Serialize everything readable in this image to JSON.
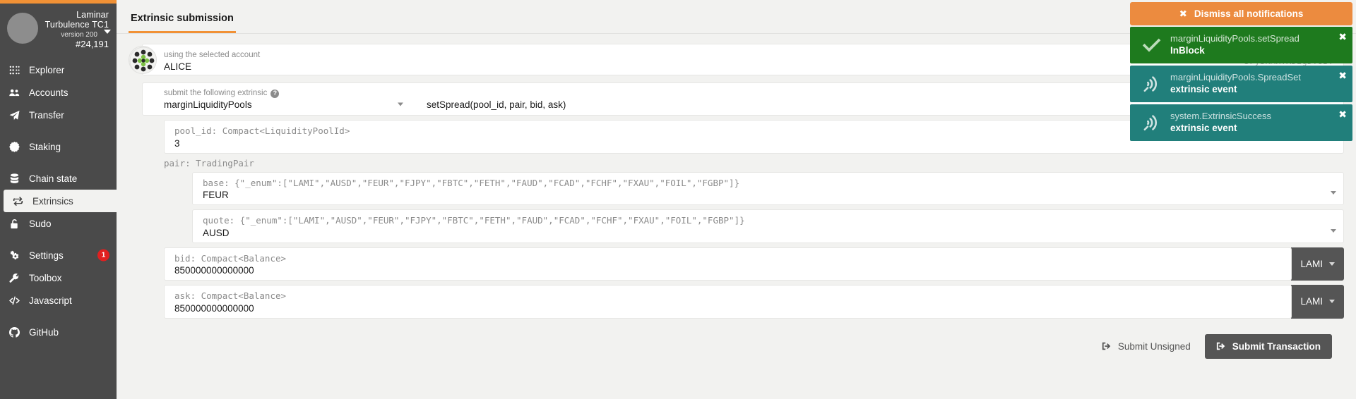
{
  "sidebar": {
    "chain": {
      "name": "Laminar\nTurbulence TC1",
      "name_line1": "Laminar",
      "name_line2": "Turbulence TC1",
      "version": "version 200",
      "block": "#24,191"
    },
    "items": [
      {
        "label": "Explorer",
        "icon": "dots-grid-icon",
        "active": false,
        "badge": null,
        "spaced": false
      },
      {
        "label": "Accounts",
        "icon": "users-icon",
        "active": false,
        "badge": null,
        "spaced": false
      },
      {
        "label": "Transfer",
        "icon": "paper-plane-icon",
        "active": false,
        "badge": null,
        "spaced": false
      },
      {
        "label": "Staking",
        "icon": "certificate-icon",
        "active": false,
        "badge": null,
        "spaced": true
      },
      {
        "label": "Chain state",
        "icon": "database-icon",
        "active": false,
        "badge": null,
        "spaced": true
      },
      {
        "label": "Extrinsics",
        "icon": "exchange-icon",
        "active": true,
        "badge": null,
        "spaced": false
      },
      {
        "label": "Sudo",
        "icon": "unlock-icon",
        "active": false,
        "badge": null,
        "spaced": false
      },
      {
        "label": "Settings",
        "icon": "gears-icon",
        "active": false,
        "badge": "1",
        "spaced": true
      },
      {
        "label": "Toolbox",
        "icon": "wrench-icon",
        "active": false,
        "badge": null,
        "spaced": false
      },
      {
        "label": "Javascript",
        "icon": "code-icon",
        "active": false,
        "badge": null,
        "spaced": false
      },
      {
        "label": "GitHub",
        "icon": "github-icon",
        "active": false,
        "badge": null,
        "spaced": true
      }
    ]
  },
  "tabs": [
    {
      "label": "Extrinsic submission",
      "active": true
    }
  ],
  "account": {
    "label": "using the selected account",
    "name": "ALICE",
    "address": "5FySxAHYXDzgDY8BT"
  },
  "extrinsic": {
    "label": "submit the following extrinsic",
    "help_icon": "question-circle-icon",
    "module": "marginLiquidityPools",
    "method": "setSpread(pool_id, pair, bid, ask)"
  },
  "params": [
    {
      "kind": "simple",
      "type": "pool_id: Compact<LiquidityPoolId>",
      "value": "3",
      "unit": null,
      "caret": false
    }
  ],
  "pair_group": {
    "label": "pair: TradingPair",
    "fields": [
      {
        "type": "base: {\"_enum\":[\"LAMI\",\"AUSD\",\"FEUR\",\"FJPY\",\"FBTC\",\"FETH\",\"FAUD\",\"FCAD\",\"FCHF\",\"FXAU\",\"FOIL\",\"FGBP\"]}",
        "value": "FEUR",
        "caret": true
      },
      {
        "type": "quote: {\"_enum\":[\"LAMI\",\"AUSD\",\"FEUR\",\"FJPY\",\"FBTC\",\"FETH\",\"FAUD\",\"FCAD\",\"FCHF\",\"FXAU\",\"FOIL\",\"FGBP\"]}",
        "value": "AUSD",
        "caret": true
      }
    ]
  },
  "balance_params": [
    {
      "type": "bid: Compact<Balance>",
      "value": "850000000000000",
      "unit": "LAMI"
    },
    {
      "type": "ask: Compact<Balance>",
      "value": "850000000000000",
      "unit": "LAMI"
    }
  ],
  "footer": {
    "submit_unsigned": "Submit Unsigned",
    "submit_transaction": "Submit Transaction",
    "icon": "sign-in-icon"
  },
  "notifications": {
    "dismiss_all": "Dismiss all notifications",
    "dismiss_icon": "close-icon",
    "items": [
      {
        "title": "marginLiquidityPools.setSpread",
        "sub": "InBlock",
        "style": "green",
        "icon": "check-icon",
        "close": "close-icon"
      },
      {
        "title": "marginLiquidityPools.SpreadSet",
        "sub": "extrinsic event",
        "style": "teal",
        "icon": "broadcast-icon",
        "close": "close-icon"
      },
      {
        "title": "system.ExtrinsicSuccess",
        "sub": "extrinsic event",
        "style": "teal",
        "icon": "broadcast-icon",
        "close": "close-icon"
      }
    ]
  },
  "colors": {
    "accent": "#f19135",
    "sidebar_bg": "#4a4a4a",
    "page_bg": "#f2f2f0",
    "success": "#1e7a1e",
    "info": "#217f7b",
    "badge": "#e02020",
    "button_dark": "#555555"
  }
}
